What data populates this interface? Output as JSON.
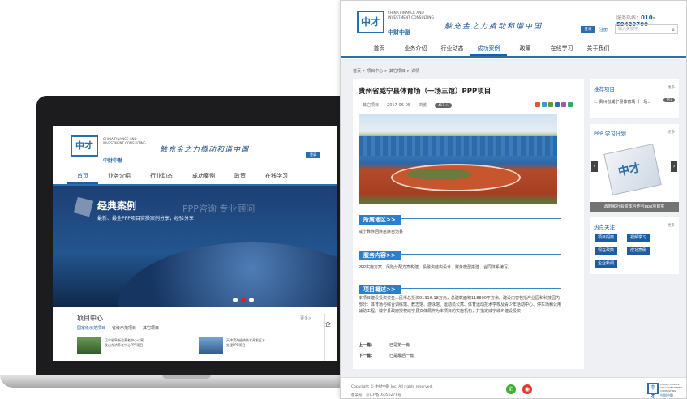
{
  "laptop": {
    "logo_mark": "中才",
    "logo_en": "CHINA FINANCE AND INVESTMENT CONSULTING",
    "logo_cn": "中财中融",
    "slogan": "触充金之力撬动和谐中国",
    "login_btn": "登录",
    "nav": [
      "首页",
      "业务介绍",
      "行业动态",
      "成功案例",
      "政策",
      "在线学习"
    ],
    "active_nav": "首页",
    "banner_title": "经典案例",
    "banner_sub": "最新、最全PPP项目实操案例分享，经验分享",
    "banner_ghost": "PPP咨询 专业顾问",
    "section_title": "项目中心",
    "section_more": "更多>",
    "tabs": [
      "国家级示范项目",
      "省级示范项目",
      "其它项目"
    ],
    "items": [
      "辽宁省阜新县养老中心公寓及山东济养老中心PPP项目",
      "天津滨海经济技术开发区水处理PPP项目"
    ],
    "side_label": "企"
  },
  "site": {
    "logo_mark": "中才",
    "logo_en": "CHINA FINANCE AND INVESTMENT CONSULTING",
    "logo_cn": "中财中融",
    "slogan": "触充金之力撬动和谐中国",
    "hotline_label": "服务热线：",
    "hotline": "010-59439700",
    "login_btn": "登录",
    "register": "注册",
    "search_placeholder": "输入关键字",
    "nav": [
      "首页",
      "业务介绍",
      "行业动态",
      "成功案例",
      "政策",
      "在线学习",
      "关于我们"
    ],
    "active_nav": "成功案例"
  },
  "breadcrumb": "首页 > 项目中心 > 其它项目 > 详情",
  "article": {
    "title": "贵州省威宁县体育场（一场三馆）PPP项目",
    "category": "其它项目",
    "date": "2017-06-05",
    "views_label": "浏览",
    "views": "417 人",
    "sections": [
      {
        "title": "所属地区>>",
        "text": "威宁彝族回族苗族自治县"
      },
      {
        "title": "服务内容>>",
        "text": "PPP实施方案、风险分配方案构建、投融资结构设计、财务模型搭建、合同体系编写。"
      },
      {
        "title": "项目概述>>",
        "text": "本项目建设投资资金人民币总投资91316.18万元，总建筑面积118800平方米。建设内容包括产业园和科技园内部分：体育场与综合训练馆、教志馆、游泳馆、运动员公寓、体育运动技术学校及青少年活动中心、停车场和公用辅助工程。威宁县政府授权威宁县文体局作为本项目的实施机构，并指定威宁城乡建设投资"
      }
    ],
    "prev_label": "上一篇：",
    "prev": "已是第一篇",
    "next_label": "下一篇：",
    "next": "已是最后一篇"
  },
  "sidebar": {
    "recommend_title": "推荐项目",
    "recommend_more": "更多",
    "recommend_item": "1. 贵州省威宁县体育场（一场...",
    "recommend_count": "158",
    "study_title": "PPP 学习计划",
    "study_more": "更多",
    "study_caption": "政府和社会资本合作与ppp项目实",
    "cube_mark": "中才",
    "hot_title": "热点关注",
    "hot_more": "更多",
    "tags": [
      "项目招商",
      "视频学习",
      "现在政策",
      "成功案例",
      "企业新闻"
    ]
  },
  "footer": {
    "copyright": "Copyright © 中财中融 Inc. All rights reserved.",
    "icp": "备案号：京ICP备16056271号",
    "logo_mark": "中才",
    "logo_en": "CHINA FINANCE AND INVESTMENT CONSULTING",
    "logo_cn": "中财中融",
    "wechat_glyph": "✆",
    "weibo_glyph": "◉"
  },
  "colors": {
    "brand": "#2a6fa8",
    "nav_active": "#1a5fa8",
    "section_title": "#2a7fcf",
    "tag": "#1c5da3"
  }
}
